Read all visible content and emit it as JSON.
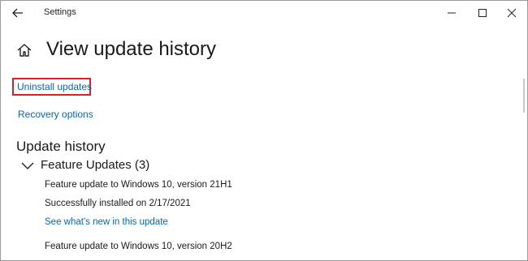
{
  "window": {
    "title": "Settings",
    "controls": [
      "back-arrow-icon",
      "minimize-icon",
      "maximize-icon",
      "close-icon"
    ]
  },
  "page": {
    "title": "View update history",
    "icon": "home-icon"
  },
  "links": {
    "uninstall": "Uninstall updates",
    "recovery": "Recovery options"
  },
  "history": {
    "section_title": "Update history",
    "group": {
      "label": "Feature Updates (3)",
      "expanded": true,
      "items": [
        {
          "title": "Feature update to Windows 10, version 21H1",
          "status": "Successfully installed on 2/17/2021",
          "link": "See what's new in this update"
        },
        {
          "title": "Feature update to Windows 10, version 20H2"
        }
      ]
    }
  },
  "colors": {
    "link": "#0067c0",
    "highlight": "#d3212d",
    "text": "#1a1a1a",
    "border": "#9a9a9a"
  }
}
